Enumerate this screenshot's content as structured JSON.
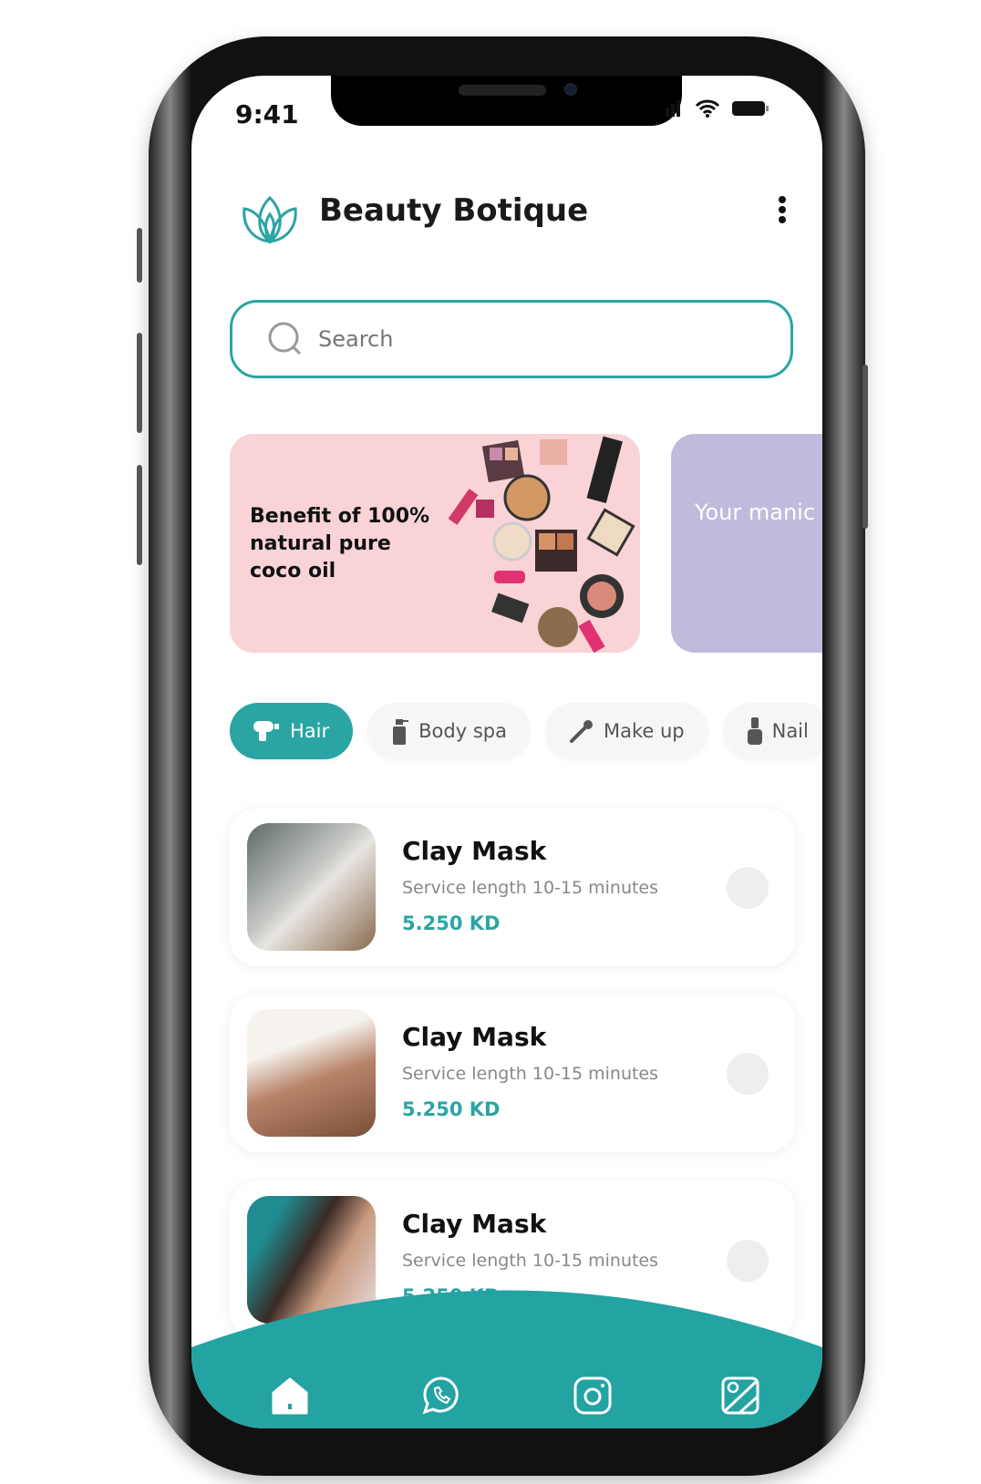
{
  "status_bar": {
    "time": "9:41"
  },
  "header": {
    "title": "Beauty Botique",
    "menu_icon": "kebab-icon",
    "logo_icon": "lotus-icon"
  },
  "search": {
    "placeholder": "Search",
    "icon": "search-icon"
  },
  "banners": [
    {
      "text": "Benefit of 100% natural pure coco oil",
      "color": "#f9d3d6"
    },
    {
      "text": "Your manic",
      "color": "#c0bbdb"
    }
  ],
  "categories": [
    {
      "label": "Hair",
      "icon": "hair-dryer-icon",
      "active": true
    },
    {
      "label": "Body spa",
      "icon": "spray-bottle-icon",
      "active": false
    },
    {
      "label": "Make up",
      "icon": "makeup-brush-icon",
      "active": false
    },
    {
      "label": "Nail",
      "icon": "nail-polish-icon",
      "active": false
    }
  ],
  "services": [
    {
      "name": "Clay Mask",
      "subtitle": "Service length 10-15 minutes",
      "price": "5.250 KD"
    },
    {
      "name": "Clay Mask",
      "subtitle": "Service length 10-15 minutes",
      "price": "5.250 KD"
    },
    {
      "name": "Clay Mask",
      "subtitle": "Service length 10-15 minutes",
      "price": "5.250 KD"
    }
  ],
  "bottom_nav": [
    {
      "icon": "home-icon",
      "active": true
    },
    {
      "icon": "whatsapp-icon"
    },
    {
      "icon": "instagram-icon"
    },
    {
      "icon": "map-icon"
    }
  ],
  "colors": {
    "accent": "#2aa5a3",
    "banner_pink": "#f9d3d6",
    "banner_purple": "#c0bbdb"
  }
}
